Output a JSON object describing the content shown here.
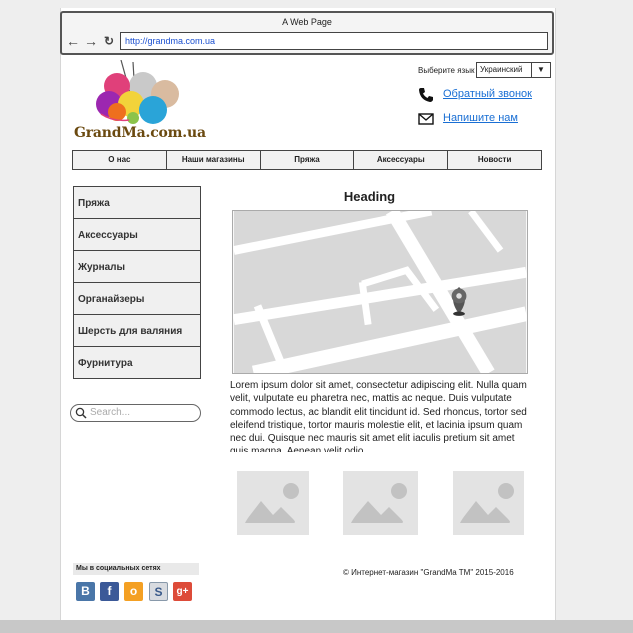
{
  "browser": {
    "title": "A Web Page",
    "url": "http://grandma.com.ua"
  },
  "logo": {
    "text": "GrandMa.com.ua"
  },
  "header": {
    "language_label": "Выберите язык",
    "language_value": "Украинский",
    "callback_link": "Обратный звонок",
    "write_link": "Напишите нам"
  },
  "topnav": [
    "О нас",
    "Наши магазины",
    "Пряжа",
    "Аксессуары",
    "Новости"
  ],
  "sidebar": [
    "Пряжа",
    "Аксессуары",
    "Журналы",
    "Органайзеры",
    "Шерсть для валяния",
    "Фурнитура"
  ],
  "search": {
    "placeholder": "Search..."
  },
  "main": {
    "heading": "Heading",
    "body": "Lorem ipsum dolor sit amet, consectetur adipiscing elit. Nulla quam velit, vulputate eu pharetra nec, mattis ac neque. Duis vulputate commodo lectus, ac blandit elit tincidunt id. Sed rhoncus, tortor sed eleifend tristique, tortor mauris molestie elit, et lacinia ipsum quam nec dui. Quisque nec mauris sit amet elit iaculis pretium sit amet quis magna. Aenean velit odio"
  },
  "social": {
    "title": "Мы в социальных сетях",
    "icons": [
      "vk-icon",
      "facebook-icon",
      "odnoklassniki-icon",
      "skype-icon",
      "google-plus-icon"
    ]
  },
  "footer": {
    "copyright": "© Интернет-магазин \"GrandMa TM\" 2015-2016"
  },
  "colors": {
    "link": "#1a6fd4",
    "brand": "#6b4a10",
    "vk": "#4a76a8",
    "facebook": "#3b5998",
    "odnoklassniki": "#f4a023",
    "google": "#dd4b39"
  }
}
